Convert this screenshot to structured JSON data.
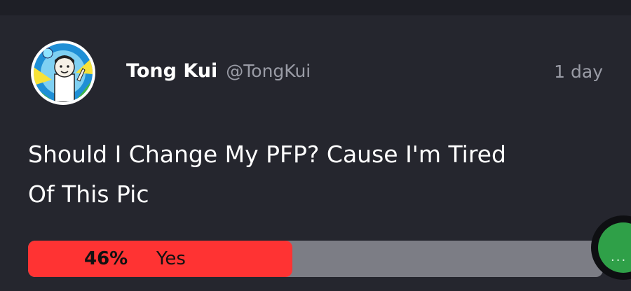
{
  "post": {
    "author": {
      "name": "Tong Kui",
      "handle": "@TongKui",
      "avatar_icon": "avatar-cartoon-icon"
    },
    "timestamp": "1 day",
    "body_lines": [
      "Should I Change My PFP? Cause I'm Tired",
      "Of This Pic"
    ],
    "poll": {
      "options": [
        {
          "percent_label": "46%",
          "label": "Yes",
          "fill_fraction": 0.46
        }
      ]
    }
  },
  "fab": {
    "icon": "more-dots-icon",
    "glyph": "···"
  },
  "colors": {
    "background": "#25262e",
    "topbar": "#1e1f26",
    "poll_fill": "#ff3333",
    "poll_track": "#7c7d85",
    "fab_green": "#2fa048",
    "secondary_text": "#9a9ca6"
  }
}
